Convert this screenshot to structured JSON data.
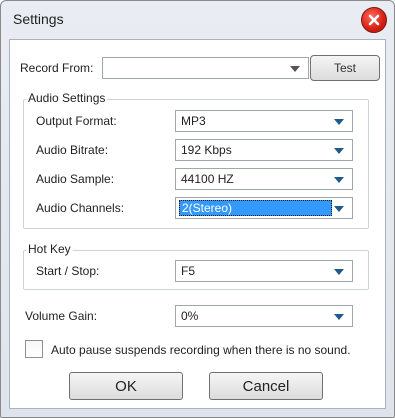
{
  "window": {
    "title": "Settings",
    "close_icon": "close-icon"
  },
  "record": {
    "label": "Record  From:",
    "value": "",
    "test_label": "Test"
  },
  "audio_settings": {
    "title": "Audio Settings",
    "output_format": {
      "label": "Output Format:",
      "value": "MP3"
    },
    "audio_bitrate": {
      "label": "Audio Bitrate:",
      "value": "192 Kbps"
    },
    "audio_sample": {
      "label": "Audio Sample:",
      "value": "44100 HZ"
    },
    "audio_channels": {
      "label": "Audio Channels:",
      "value": "2(Stereo)"
    }
  },
  "hot_key": {
    "title": "Hot Key",
    "start_stop": {
      "label": "Start / Stop:",
      "value": "F5"
    }
  },
  "volume_gain": {
    "label": "Volume Gain:",
    "value": "0%"
  },
  "auto_pause": {
    "label": "Auto pause suspends recording when there is no sound.",
    "checked": false
  },
  "buttons": {
    "ok": "OK",
    "cancel": "Cancel"
  },
  "colors": {
    "close_red": "#d41f14",
    "selection_blue": "#3399ff",
    "arrow_blue": "#1f5a8a"
  }
}
